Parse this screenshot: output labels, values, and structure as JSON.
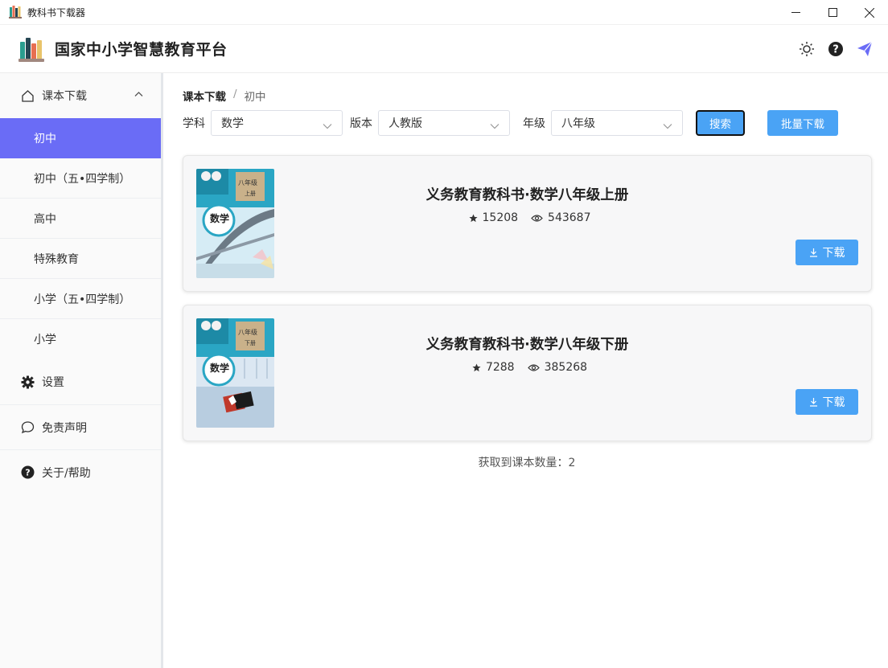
{
  "window": {
    "title": "教科书下载器",
    "controls": [
      "minimize",
      "maximize",
      "close"
    ]
  },
  "header": {
    "brand": "国家中小学智慧教育平台",
    "actions": [
      "sun-icon",
      "help-circle-icon",
      "send-icon"
    ]
  },
  "sidebar": {
    "download_group": "课本下载",
    "items": [
      {
        "label": "初中",
        "active": true
      },
      {
        "label": "初中（五•四学制）",
        "active": false
      },
      {
        "label": "高中",
        "active": false
      },
      {
        "label": "特殊教育",
        "active": false
      },
      {
        "label": "小学（五•四学制）",
        "active": false
      },
      {
        "label": "小学",
        "active": false
      }
    ],
    "settings": "设置",
    "disclaimer": "免责声明",
    "about": "关于/帮助"
  },
  "breadcrumb": {
    "root": "课本下载",
    "separator": "/",
    "current": "初中"
  },
  "filters": {
    "subject_label": "学科",
    "subject_value": "数学",
    "edition_label": "版本",
    "edition_value": "人教版",
    "grade_label": "年级",
    "grade_value": "八年级",
    "search_button": "搜索",
    "batch_button": "批量下载"
  },
  "books": [
    {
      "title": "义务教育教科书·数学八年级上册",
      "stars": "15208",
      "views": "543687",
      "download": "下载",
      "cover": {
        "subject": "数学",
        "grade": "八年级",
        "volume": "上册"
      }
    },
    {
      "title": "义务教育教科书·数学八年级下册",
      "stars": "7288",
      "views": "385268",
      "download": "下载",
      "cover": {
        "subject": "数学",
        "grade": "八年级",
        "volume": "下册"
      }
    }
  ],
  "footer": {
    "count_text": "获取到课本数量：2"
  },
  "colors": {
    "accent": "#4aa3f5",
    "active_nav": "#6a6cf6"
  }
}
